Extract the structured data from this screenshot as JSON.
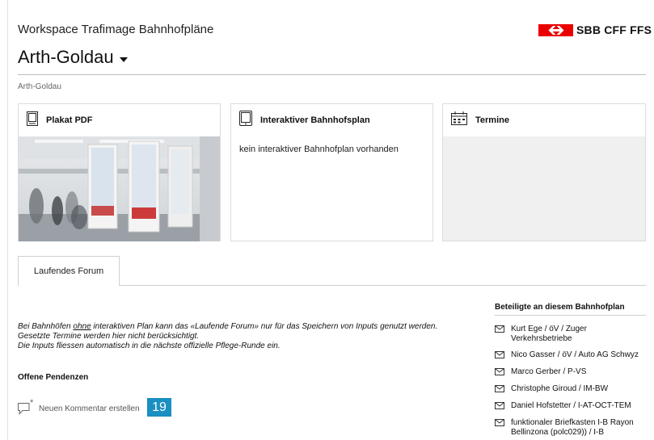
{
  "header": {
    "workspace_title": "Workspace Trafimage Bahnhofpläne",
    "brand_text": "SBB CFF FFS",
    "station_name": "Arth-Goldau"
  },
  "breadcrumb": "Arth-Goldau",
  "cards": {
    "poster": {
      "title": "Plakat PDF"
    },
    "interactive": {
      "title": "Interaktiver Bahnhofsplan",
      "body": "kein interaktiver Bahnhofplan vorhanden"
    },
    "termine": {
      "title": "Termine"
    }
  },
  "tabs": [
    {
      "label": "Laufendes Forum"
    }
  ],
  "notice": {
    "line1_pre": "Bei Bahnhöfen ",
    "line1_underline": "ohne",
    "line1_post": " interaktiven Plan kann das «Laufende Forum» nur für das Speichern von Inputs genutzt werden.",
    "line2": "Gesetzte Termine werden hier nicht berücksichtigt.",
    "line3": "Die Inputs fliessen automatisch in die nächste offizielle Pflege-Runde ein."
  },
  "pendenzen": {
    "title": "Offene Pendenzen",
    "new_comment_label": "Neuen Kommentar erstellen",
    "badge": "19"
  },
  "participants": {
    "title": "Beteiligte an diesem Bahnhofplan",
    "items": [
      "Kurt Ege / öV / Zuger Verkehrsbetriebe",
      "Nico Gasser / öV / Auto AG Schwyz",
      "Marco Gerber / P-VS",
      "Christophe Giroud / IM-BW",
      "Daniel Hofstetter / I-AT-OCT-TEM",
      "funktionaler Briefkasten I-B Rayon Bellinzona (polc029)) / I-B"
    ]
  },
  "colors": {
    "brand_red": "#eb0000",
    "badge_blue": "#1a8fc2"
  }
}
